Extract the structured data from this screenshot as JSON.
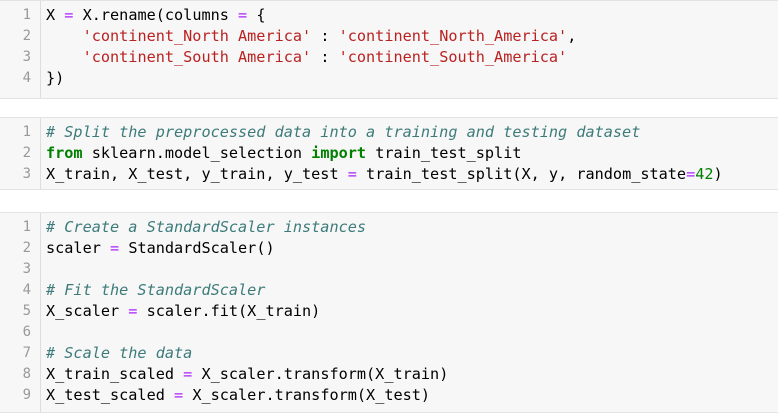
{
  "cells": [
    {
      "lines": [
        {
          "n": "1",
          "segs": [
            {
              "t": "X ",
              "c": ""
            },
            {
              "t": "=",
              "c": "op"
            },
            {
              "t": " X.rename(columns ",
              "c": ""
            },
            {
              "t": "=",
              "c": "op"
            },
            {
              "t": " {",
              "c": ""
            }
          ]
        },
        {
          "n": "2",
          "segs": [
            {
              "t": "    ",
              "c": ""
            },
            {
              "t": "'continent_North America'",
              "c": "str"
            },
            {
              "t": " : ",
              "c": ""
            },
            {
              "t": "'continent_North_America'",
              "c": "str"
            },
            {
              "t": ",",
              "c": ""
            }
          ]
        },
        {
          "n": "3",
          "segs": [
            {
              "t": "    ",
              "c": ""
            },
            {
              "t": "'continent_South America'",
              "c": "str"
            },
            {
              "t": " : ",
              "c": ""
            },
            {
              "t": "'continent_South_America'",
              "c": "str"
            }
          ]
        },
        {
          "n": "4",
          "segs": [
            {
              "t": "})",
              "c": ""
            }
          ]
        }
      ]
    },
    {
      "lines": [
        {
          "n": "1",
          "segs": [
            {
              "t": "# Split the preprocessed data into a training and testing dataset",
              "c": "cm"
            }
          ]
        },
        {
          "n": "2",
          "segs": [
            {
              "t": "from",
              "c": "kw"
            },
            {
              "t": " sklearn.model_selection ",
              "c": ""
            },
            {
              "t": "import",
              "c": "kw"
            },
            {
              "t": " train_test_split",
              "c": ""
            }
          ]
        },
        {
          "n": "3",
          "segs": [
            {
              "t": "X_train, X_test, y_train, y_test ",
              "c": ""
            },
            {
              "t": "=",
              "c": "op"
            },
            {
              "t": " train_test_split(X, y, random_state",
              "c": ""
            },
            {
              "t": "=",
              "c": "op"
            },
            {
              "t": "42",
              "c": "num"
            },
            {
              "t": ")",
              "c": ""
            }
          ]
        }
      ]
    },
    {
      "lines": [
        {
          "n": "1",
          "segs": [
            {
              "t": "# Create a StandardScaler instances",
              "c": "cm"
            }
          ]
        },
        {
          "n": "2",
          "segs": [
            {
              "t": "scaler ",
              "c": ""
            },
            {
              "t": "=",
              "c": "op"
            },
            {
              "t": " StandardScaler()",
              "c": ""
            }
          ]
        },
        {
          "n": "3",
          "segs": []
        },
        {
          "n": "4",
          "segs": [
            {
              "t": "# Fit the StandardScaler",
              "c": "cm"
            }
          ]
        },
        {
          "n": "5",
          "segs": [
            {
              "t": "X_scaler ",
              "c": ""
            },
            {
              "t": "=",
              "c": "op"
            },
            {
              "t": " scaler.fit(X_train)",
              "c": ""
            }
          ]
        },
        {
          "n": "6",
          "segs": []
        },
        {
          "n": "7",
          "segs": [
            {
              "t": "# Scale the data",
              "c": "cm"
            }
          ]
        },
        {
          "n": "8",
          "segs": [
            {
              "t": "X_train_scaled ",
              "c": ""
            },
            {
              "t": "=",
              "c": "op"
            },
            {
              "t": " X_scaler.transform(X_train)",
              "c": ""
            }
          ]
        },
        {
          "n": "9",
          "segs": [
            {
              "t": "X_test_scaled ",
              "c": ""
            },
            {
              "t": "=",
              "c": "op"
            },
            {
              "t": " X_scaler.transform(X_test)",
              "c": ""
            }
          ]
        }
      ]
    }
  ]
}
